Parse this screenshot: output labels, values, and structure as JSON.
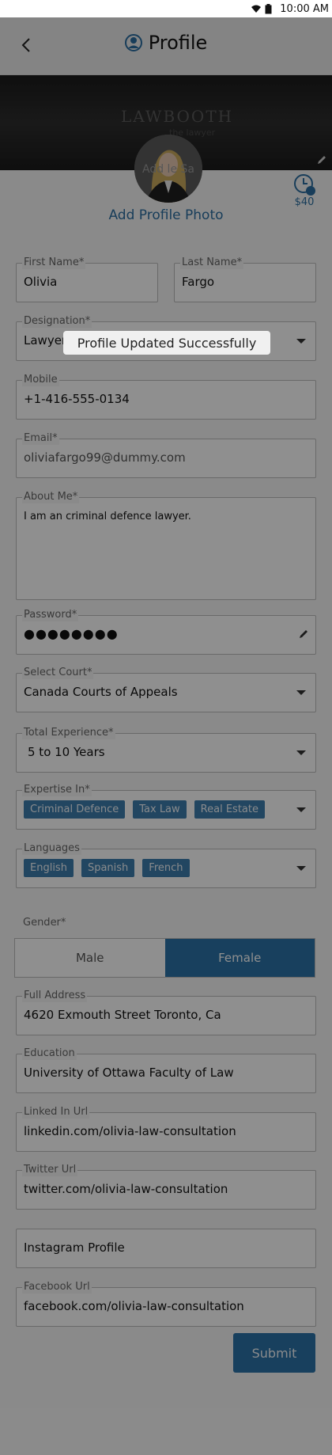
{
  "status_bar": {
    "time": "10:00 AM",
    "icons": [
      "wifi-icon",
      "battery-icon"
    ]
  },
  "header": {
    "title": "Profile",
    "back_icon": "chevron-left-icon",
    "title_icon": "user-circle-icon"
  },
  "banner": {
    "logo_text": "LAWBOOTH",
    "logo_sub": "the lawyer",
    "edit_icon": "pencil-icon"
  },
  "profile_photo": {
    "add_label": "Add Profile Photo",
    "overlay_text": "Add le Sa"
  },
  "credits": {
    "amount": "$40",
    "icon": "clock-icon"
  },
  "form": {
    "first_name": {
      "label": "First Name*",
      "value": "Olivia"
    },
    "last_name": {
      "label": "Last Name*",
      "value": "Fargo"
    },
    "designation": {
      "label": "Designation*",
      "value": "Lawyer"
    },
    "mobile": {
      "label": "Mobile",
      "value": "+1-416-555-0134"
    },
    "email": {
      "label": "Email*",
      "value": "oliviafargo99@dummy.com"
    },
    "about": {
      "label": "About Me*",
      "value": "I am an criminal defence lawyer."
    },
    "password": {
      "label": "Password*",
      "value": "●●●●●●●●"
    },
    "court": {
      "label": "Select Court*",
      "value": "Canada Courts of Appeals"
    },
    "experience": {
      "label": "Total Experience*",
      "value": "5 to 10 Years"
    },
    "expertise": {
      "label": "Expertise In*",
      "chips": [
        "Criminal Defence",
        "Tax Law",
        "Real Estate"
      ]
    },
    "languages": {
      "label": "Languages",
      "chips": [
        "English",
        "Spanish",
        "French"
      ]
    },
    "gender": {
      "label": "Gender*",
      "options": [
        "Male",
        "Female"
      ],
      "selected": "Female"
    },
    "address": {
      "label": "Full Address",
      "value": "4620  Exmouth Street Toronto, Ca"
    },
    "education": {
      "label": "Education",
      "value": "University of Ottawa Faculty of Law"
    },
    "linkedin": {
      "label": "Linked In Url",
      "value": "linkedin.com/olivia-law-consultation"
    },
    "twitter": {
      "label": "Twitter Url",
      "value": "twitter.com/olivia-law-consultation"
    },
    "instagram": {
      "placeholder": "Instagram Profile"
    },
    "facebook": {
      "label": "Facebook Url",
      "value": "facebook.com/olivia-law-consultation"
    },
    "submit_label": "Submit"
  },
  "toast": {
    "message": "Profile Updated Successfully"
  },
  "colors": {
    "accent": "#2b73a8",
    "overlay": "rgba(0,0,0,0.44)"
  }
}
